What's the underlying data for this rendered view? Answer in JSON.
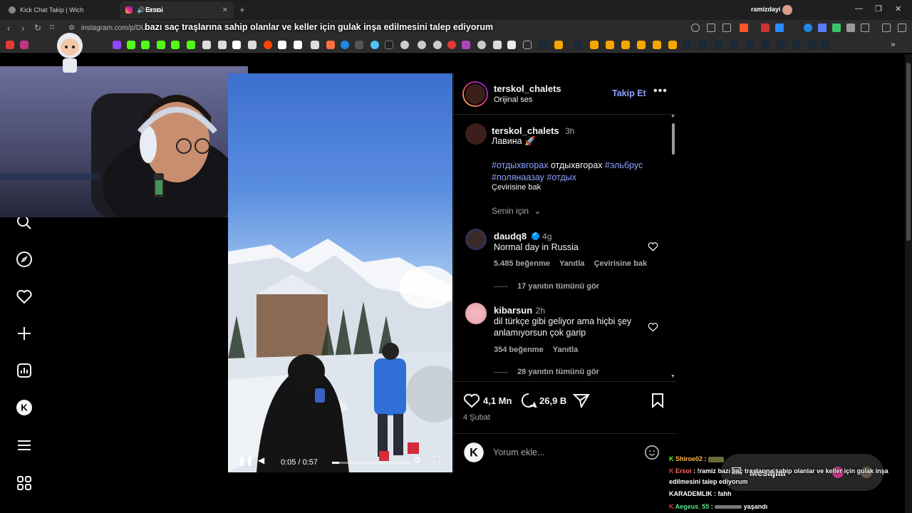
{
  "browser": {
    "tabs": [
      {
        "label": "Kick Chat Takip | Wich"
      },
      {
        "label": "Insta"
      }
    ],
    "tab_overlay_name": "Ersoi",
    "url": "instagram.com/p/DU",
    "profile_name": "ramizdayi"
  },
  "overlay_title": "bazı saç traşlarına sahip olanlar ve keller için gulak inşa edilmesini talep ediyorum",
  "post": {
    "username": "terskol_chalets",
    "audio": "Orijinal ses",
    "follow_label": "Takip Et",
    "caption_time": "3h",
    "caption": "Лавина 🚀",
    "hashtags_line1_a": "#отдыхвгорах",
    "hashtags_line1_b": "отдыхвгорах",
    "hashtags_line1_c": "#эльбрус",
    "hashtags_line2_a": "#полянаазау",
    "hashtags_line2_b": "#отдых",
    "translate_label": "Çevirisine bak",
    "for_you_label": "Senin için",
    "likes": "4,1 Mn",
    "comments_count": "26,9 B",
    "date": "4 Şubat",
    "add_comment_placeholder": "Yorum ekle...",
    "video_time": "0:05 / 0:57"
  },
  "comments": [
    {
      "username": "daudq8",
      "verified": true,
      "time": "4g",
      "text": "Normal day in Russia",
      "likes": "5.485 beğenme",
      "reply": "Yanıtla",
      "translate": "Çevirisine bak",
      "view_replies": "17 yanıtın tümünü gör"
    },
    {
      "username": "kibarsun",
      "verified": false,
      "time": "2h",
      "text_line1": "dil türkçe gibi geliyor ama hiçbi şey",
      "text_line2": "anlamıyorsun çok garip",
      "likes": "354 beğenme",
      "reply": "Yanıtla",
      "view_replies": "28 yanıtın tümünü gör"
    }
  ],
  "messages_label": "Mesajlar",
  "chat": [
    {
      "user": "Shiroe02",
      "text": "",
      "color": "#ffb347"
    },
    {
      "user": "Ersoi",
      "text": "!ramiz bazı saç traşlarına sahip olanlar ve keller için gulak inşa",
      "text2": "edilmesini talep ediyorum",
      "color": "#ff6b6b"
    },
    {
      "user": "KARADEMLIK",
      "text": "fahh",
      "color": "#ffffff"
    },
    {
      "user": "Aegeus_55",
      "text": "yaşandı",
      "color": "#5ee38b"
    }
  ],
  "colors": {
    "background": "#000000",
    "accent": "#8ea3ff",
    "follow": "#8ea3ff"
  }
}
